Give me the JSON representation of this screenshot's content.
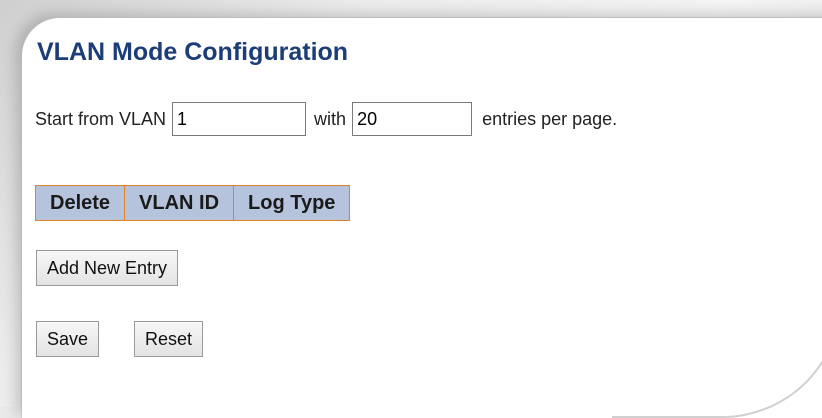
{
  "page": {
    "title": "VLAN Mode Configuration"
  },
  "paging": {
    "start_label": "Start from VLAN",
    "start_value": "1",
    "with_label": "with",
    "entries_value": "20",
    "suffix_label": "entries per page."
  },
  "table": {
    "headers": [
      "Delete",
      "VLAN ID",
      "Log Type"
    ],
    "header_bg": "#b5c4dc",
    "header_border": "#e0822a"
  },
  "buttons": {
    "add_label": "Add New Entry",
    "save_label": "Save",
    "reset_label": "Reset"
  },
  "colors": {
    "title": "#1c3d78"
  }
}
